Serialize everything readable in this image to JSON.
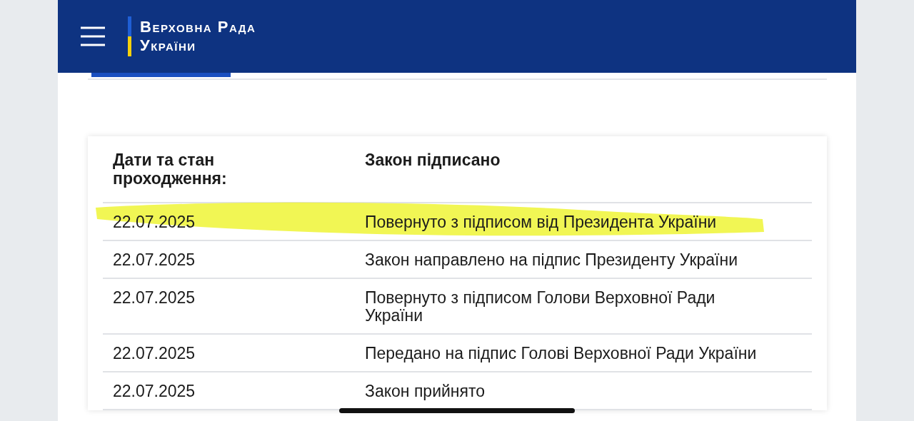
{
  "header": {
    "logo_line_1": "Верховна Рада",
    "logo_line_2": "України"
  },
  "tabs": [
    {
      "selected": true
    }
  ],
  "table": {
    "heading": "Дати та стан проходження:",
    "status": "Закон підписано",
    "rows": [
      {
        "date": "22.07.2025",
        "event": "Повернуто з підписом від Президента України",
        "highlighted": true
      },
      {
        "date": "22.07.2025",
        "event": "Закон направлено на підпис Президенту України",
        "highlighted": false
      },
      {
        "date": "22.07.2025",
        "event": "Повернуто з підписом Голови Верховної Ради України",
        "highlighted": false
      },
      {
        "date": "22.07.2025",
        "event": "Передано на підпис Голові Верховної Ради України",
        "highlighted": false
      },
      {
        "date": "22.07.2025",
        "event": "Закон прийнято",
        "highlighted": false
      }
    ]
  }
}
